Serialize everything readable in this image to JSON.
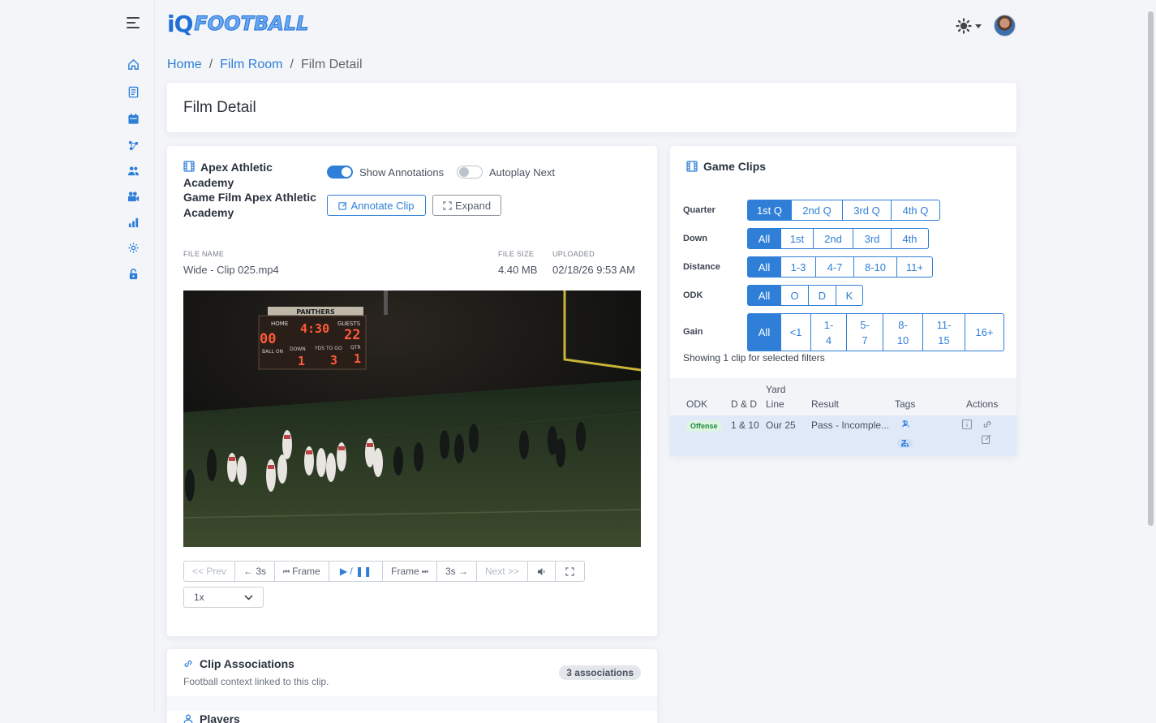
{
  "app": {
    "logo_prefix": "iQ",
    "logo_suffix": "FOOTBALL"
  },
  "sidebar": {
    "items": [
      {
        "icon": "home-icon"
      },
      {
        "icon": "playbook-icon"
      },
      {
        "icon": "calendar-icon"
      },
      {
        "icon": "plays-icon"
      },
      {
        "icon": "roster-icon"
      },
      {
        "icon": "film-room-icon"
      },
      {
        "icon": "stats-icon"
      },
      {
        "icon": "settings-icon"
      },
      {
        "icon": "lock-icon"
      }
    ]
  },
  "breadcrumb": {
    "home": "Home",
    "sep1": "/",
    "film_room": "Film Room",
    "sep2": "/",
    "current": "Film Detail"
  },
  "page": {
    "title": "Film Detail"
  },
  "film": {
    "title_line1": "Apex Athletic",
    "title_line2": "Academy",
    "title_line3": "Game Film Apex Athletic",
    "title_line4": "Academy",
    "show_annotations_label": "Show Annotations",
    "show_annotations_on": true,
    "autoplay_next_label": "Autoplay Next",
    "autoplay_next_on": false,
    "annotate_label": "Annotate Clip",
    "expand_label": "Expand",
    "file_name_label": "FILE NAME",
    "file_name": "Wide - Clip 025.mp4",
    "file_size_label": "FILE SIZE",
    "file_size": "4.40 MB",
    "uploaded_label": "UPLOADED",
    "uploaded": "02/18/26 9:53 AM",
    "scoreboard": {
      "team": "PANTHERS",
      "home_label": "HOME",
      "guests_label": "GUESTS",
      "home_score": "00",
      "clock": "4:30",
      "guest_score": "22",
      "ball_on_label": "BALL ON",
      "down_label": "DOWN",
      "yds_to_go_label": "YDS TO GO",
      "qtr_label": "QTR",
      "down": "1",
      "yds_to_go": "3",
      "qtr": "1"
    },
    "controls": {
      "prev": "<< Prev",
      "back3": "← 3s",
      "frame_back": "Frame",
      "play_pause": "▶ / ❚❚",
      "frame_fwd": "Frame",
      "fwd3": "3s →",
      "next": "Next >>"
    },
    "speed": "1x"
  },
  "clips": {
    "title": "Game Clips",
    "quarter_label": "Quarter",
    "quarter_options": [
      "1st Q",
      "2nd Q",
      "3rd Q",
      "4th Q"
    ],
    "down_label": "Down",
    "down_options": [
      "All",
      "1st",
      "2nd",
      "3rd",
      "4th"
    ],
    "distance_label": "Distance",
    "distance_options": [
      "All",
      "1-3",
      "4-7",
      "8-10",
      "11+"
    ],
    "odk_label": "ODK",
    "odk_options": [
      "All",
      "O",
      "D",
      "K"
    ],
    "gain_label": "Gain",
    "gain_options": [
      {
        "l1": "All",
        "l2": ""
      },
      {
        "l1": "<1",
        "l2": ""
      },
      {
        "l1": "1-",
        "l2": "4"
      },
      {
        "l1": "5-",
        "l2": "7"
      },
      {
        "l1": "8-",
        "l2": "10"
      },
      {
        "l1": "11-",
        "l2": "15"
      },
      {
        "l1": "16+",
        "l2": ""
      }
    ],
    "showing_text": "Showing 1 clip for selected filters",
    "columns": {
      "odk": "ODK",
      "dd": "D & D",
      "yard_line_1": "Yard",
      "yard_line_2": "Line",
      "result": "Result",
      "tags": "Tags",
      "actions": "Actions"
    },
    "rows": [
      {
        "odk": "Offense",
        "dd": "1 & 10",
        "yard_line": "Our 25",
        "result": "Pass - Incomple...",
        "players_count": "1",
        "plays_count": "2"
      }
    ]
  },
  "associations": {
    "title": "Clip Associations",
    "subtitle": "Football context linked to this clip.",
    "count": "3 associations",
    "players_label": "Players"
  }
}
